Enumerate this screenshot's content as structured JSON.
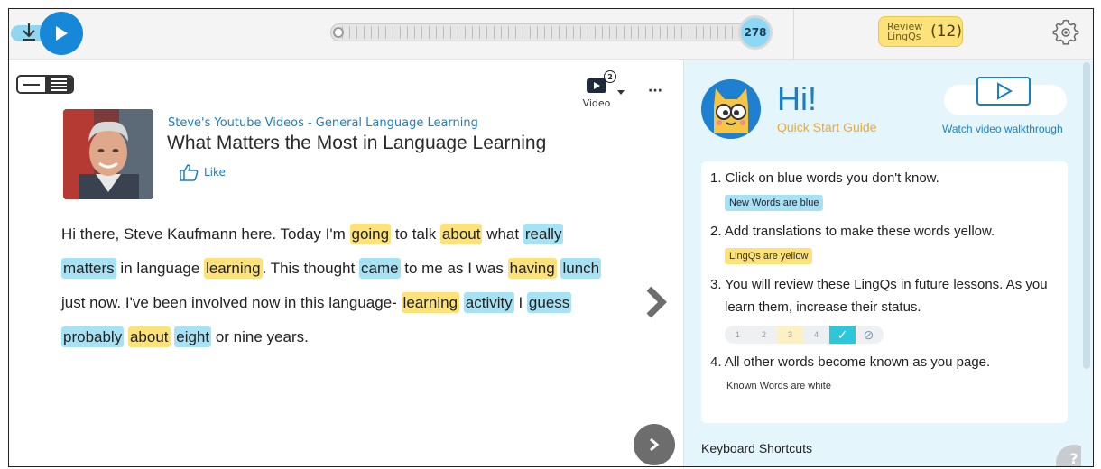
{
  "player": {
    "progress_count": "278"
  },
  "review": {
    "label": "Review LingQs",
    "count": "(12)"
  },
  "toolbar": {
    "video_label": "Video",
    "video_badge": "2",
    "more_label": "···"
  },
  "lesson": {
    "course": "Steve's Youtube Videos - General Language Learning",
    "title": "What Matters the Most in Language Learning",
    "like_label": "Like",
    "paragraph": [
      {
        "t": "Hi there, Steve Kaufmann here. Today I'm ",
        "s": ""
      },
      {
        "t": "going",
        "s": "yellow"
      },
      {
        "t": " to talk ",
        "s": ""
      },
      {
        "t": "about",
        "s": "yellow"
      },
      {
        "t": " what ",
        "s": ""
      },
      {
        "t": "really",
        "s": "blue"
      },
      {
        "t": " ",
        "s": ""
      },
      {
        "t": "matters",
        "s": "blue"
      },
      {
        "t": " in language ",
        "s": ""
      },
      {
        "t": "learning",
        "s": "yellow"
      },
      {
        "t": ". This thought ",
        "s": ""
      },
      {
        "t": "came",
        "s": "blue"
      },
      {
        "t": " to me as I was ",
        "s": ""
      },
      {
        "t": "having",
        "s": "yellow"
      },
      {
        "t": " ",
        "s": ""
      },
      {
        "t": "lunch",
        "s": "blue"
      },
      {
        "t": " just now. I've been involved now in this language- ",
        "s": ""
      },
      {
        "t": "learning",
        "s": "yellow"
      },
      {
        "t": " ",
        "s": ""
      },
      {
        "t": "activity",
        "s": "blue"
      },
      {
        "t": " I ",
        "s": ""
      },
      {
        "t": "guess",
        "s": "blue"
      },
      {
        "t": " ",
        "s": ""
      },
      {
        "t": "probably",
        "s": "blue"
      },
      {
        "t": " ",
        "s": ""
      },
      {
        "t": "about",
        "s": "yellow"
      },
      {
        "t": " ",
        "s": ""
      },
      {
        "t": "eight",
        "s": "blue"
      },
      {
        "t": " or nine years.",
        "s": ""
      }
    ]
  },
  "guide": {
    "hi": "Hi!",
    "subtitle": "Quick Start Guide",
    "walkthrough": "Watch video walkthrough",
    "step1": "1. Click on blue words you don't know.",
    "chip1": "New Words are blue",
    "step2": "2. Add translations to make these words yellow.",
    "chip2": "LingQs are yellow",
    "step3": "3. You will review these LingQs in future lessons. As you learn them, increase their status.",
    "status_levels": [
      "1",
      "2",
      "3",
      "4"
    ],
    "step4": "4. All other words become known as you page.",
    "note4": "Known Words are white",
    "shortcuts": "Keyboard Shortcuts",
    "help": "?"
  },
  "colors": {
    "accent": "#1787d8",
    "new_word": "#a7e2f4",
    "lingq": "#fde27a",
    "known_check": "#2ec7d9"
  }
}
